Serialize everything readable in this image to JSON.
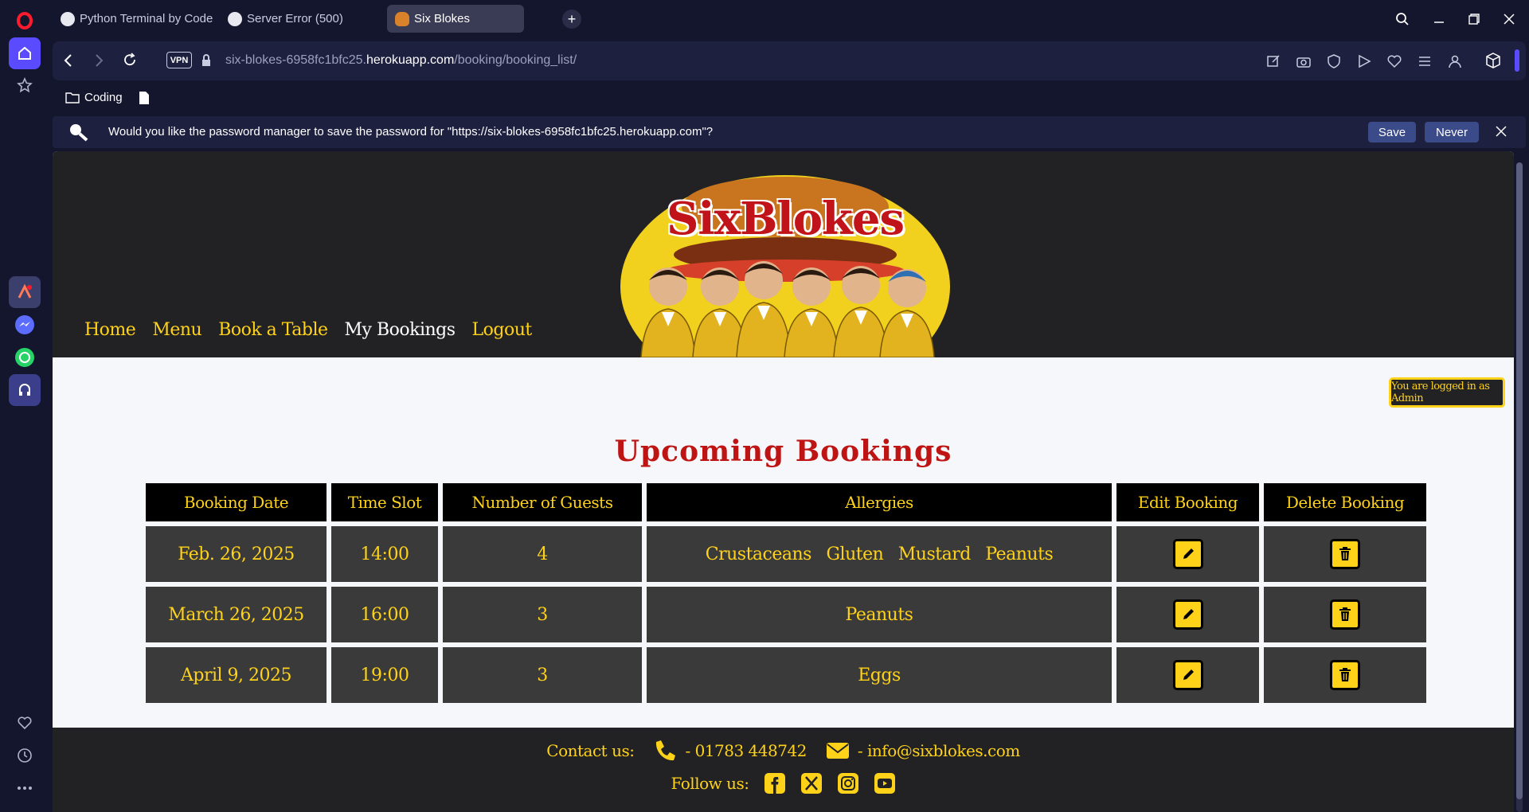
{
  "browser": {
    "tabs": [
      {
        "title": "Python Terminal by Code"
      },
      {
        "title": "Server Error (500)"
      },
      {
        "title": "Six Blokes"
      }
    ],
    "address": {
      "vpn_label": "VPN",
      "url_prefix": "six-blokes-6958fc1bfc25.",
      "url_domain": "herokuapp.com",
      "url_path": "/booking/booking_list/"
    },
    "bookmarks": [
      {
        "label": "Coding"
      }
    ],
    "password_bar": {
      "message": "Would you like the password manager to save the password for \"https://six-blokes-6958fc1bfc25.herokuapp.com\"?",
      "save_label": "Save",
      "never_label": "Never"
    }
  },
  "site": {
    "logo_text": "SixBlokes",
    "nav": [
      {
        "label": "Home"
      },
      {
        "label": "Menu"
      },
      {
        "label": "Book a Table"
      },
      {
        "label": "My Bookings"
      },
      {
        "label": "Logout"
      }
    ],
    "login_status": "You are logged in as Admin",
    "heading": "Upcoming Bookings",
    "table": {
      "headers": [
        "Booking Date",
        "Time Slot",
        "Number of Guests",
        "Allergies",
        "Edit Booking",
        "Delete Booking"
      ],
      "rows": [
        {
          "date": "Feb. 26, 2025",
          "time": "14:00",
          "guests": "4",
          "allergies": [
            "Crustaceans",
            "Gluten",
            "Mustard",
            "Peanuts"
          ]
        },
        {
          "date": "March 26, 2025",
          "time": "16:00",
          "guests": "3",
          "allergies": [
            "Peanuts"
          ]
        },
        {
          "date": "April 9, 2025",
          "time": "19:00",
          "guests": "3",
          "allergies": [
            "Eggs"
          ]
        }
      ]
    },
    "footer": {
      "contact_label": "Contact us:",
      "phone": "- 01783 448742",
      "email": "- info@sixblokes.com",
      "follow_label": "Follow us:",
      "social": [
        "facebook-icon",
        "x-icon",
        "instagram-icon",
        "youtube-icon"
      ]
    }
  },
  "colors": {
    "accent": "#ffd21a",
    "heading_red": "#bf1414",
    "site_dark": "#222224",
    "browser_dark": "#14162e"
  }
}
